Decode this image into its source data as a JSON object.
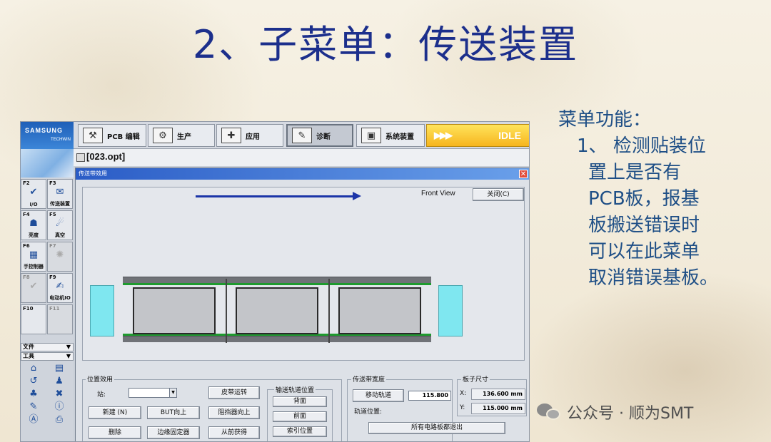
{
  "slide": {
    "title": "2、子菜单：传送装置",
    "notes": {
      "heading": "菜单功能：",
      "item_number": "1、",
      "item_lines": [
        "检测贴装位",
        "置上是否有",
        "PCB板，报基",
        "板搬送错误时",
        "可以在此菜单",
        "取消错误基板。"
      ]
    },
    "watermark": "公众号 · 顺为SMT"
  },
  "app": {
    "logo": {
      "brand": "SAMSUNG",
      "sub": "TECHWIN"
    },
    "nav_tabs": [
      {
        "label": "PCB 编辑",
        "icon": "pcb-edit-icon"
      },
      {
        "label": "生产",
        "icon": "production-icon"
      },
      {
        "label": "应用",
        "icon": "application-icon"
      },
      {
        "label": "诊断",
        "icon": "diagnosis-icon",
        "active": true
      },
      {
        "label": "系统装置",
        "icon": "system-setup-icon"
      }
    ],
    "status": {
      "arrows": "▶▶▶",
      "label": "IDLE"
    },
    "file": {
      "name": "[023.opt]"
    },
    "sidebar": {
      "fkeys": [
        {
          "key": "F2",
          "label": "I/O"
        },
        {
          "key": "F3",
          "label": "传送装置"
        },
        {
          "key": "F4",
          "label": "亮度"
        },
        {
          "key": "F5",
          "label": "真空"
        },
        {
          "key": "F6",
          "label": "手控制器"
        },
        {
          "key": "F7",
          "label": ""
        },
        {
          "key": "F8",
          "label": ""
        },
        {
          "key": "F9",
          "label": "电动机IO"
        },
        {
          "key": "F10",
          "label": ""
        },
        {
          "key": "F11",
          "label": ""
        }
      ],
      "menu_file": "文件",
      "menu_tools": "工具"
    },
    "dialog": {
      "title": "传送带效用",
      "close_symbol": "✕",
      "view_label": "Front View",
      "close_button": "关闭(C)",
      "position_group": {
        "label": "位置效用",
        "station_label": "站:",
        "station_value": "",
        "buttons": [
          "新建 (N)",
          "BUT向上",
          "皮带运转",
          "阻挡器向上",
          "删除",
          "边缘固定器",
          "从前获得"
        ]
      },
      "rail_group": {
        "label": "输送轨道位置",
        "buttons": [
          "背面",
          "前面",
          "索引位置"
        ]
      },
      "width_group": {
        "label": "传送带宽度",
        "move_button": "移动轨道",
        "width_value": "115.800",
        "rail_pos_label": "轨道位置:",
        "unload_button": "所有电路板都退出"
      },
      "board_group": {
        "label": "板子尺寸",
        "x_label": "X:",
        "x_value": "136.600 mm",
        "y_label": "Y:",
        "y_value": "115.000 mm"
      }
    }
  }
}
